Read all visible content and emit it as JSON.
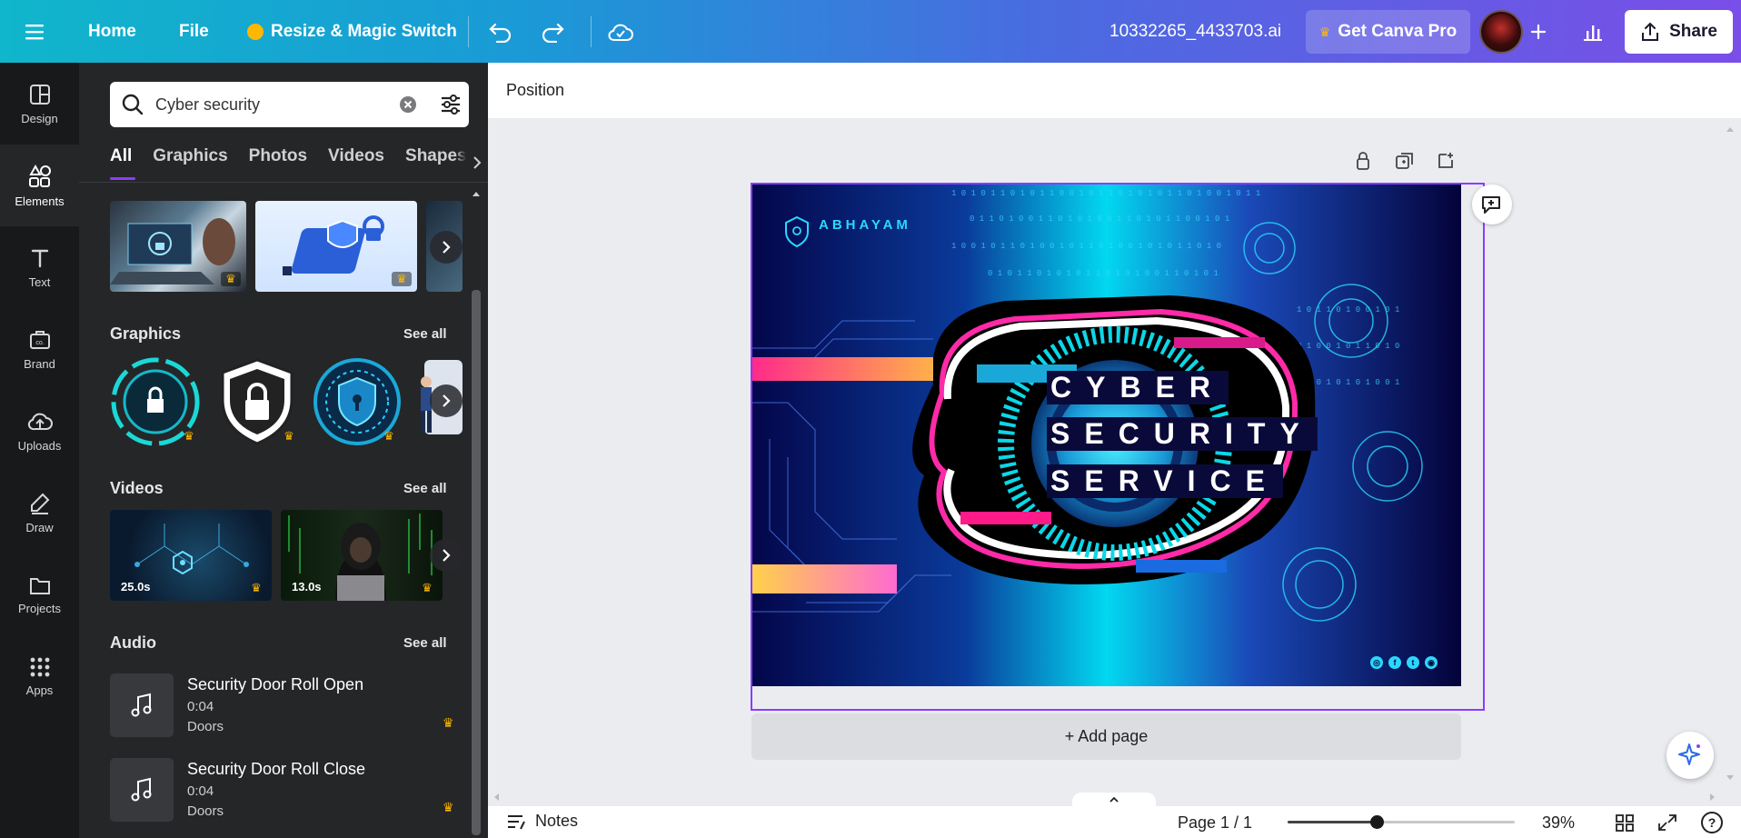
{
  "topbar": {
    "home": "Home",
    "file": "File",
    "resize": "Resize & Magic Switch",
    "filename": "10332265_4433703.ai",
    "get_pro": "Get Canva Pro",
    "share": "Share"
  },
  "sidebar": {
    "items": [
      {
        "label": "Design",
        "icon": "design-icon"
      },
      {
        "label": "Elements",
        "icon": "elements-icon"
      },
      {
        "label": "Text",
        "icon": "text-icon"
      },
      {
        "label": "Brand",
        "icon": "brand-icon"
      },
      {
        "label": "Uploads",
        "icon": "uploads-icon"
      },
      {
        "label": "Draw",
        "icon": "draw-icon"
      },
      {
        "label": "Projects",
        "icon": "projects-icon"
      },
      {
        "label": "Apps",
        "icon": "apps-icon"
      }
    ]
  },
  "panel": {
    "search_value": "Cyber security",
    "tabs": [
      "All",
      "Graphics",
      "Photos",
      "Videos",
      "Shapes"
    ],
    "graphics_title": "Graphics",
    "videos_title": "Videos",
    "audio_title": "Audio",
    "see_all": "See all",
    "videos": [
      {
        "duration": "25.0s"
      },
      {
        "duration": "13.0s"
      }
    ],
    "audio": [
      {
        "title": "Security Door Roll Open",
        "duration": "0:04",
        "artist": "Doors"
      },
      {
        "title": "Security Door Roll Close",
        "duration": "0:04",
        "artist": "Doors"
      }
    ]
  },
  "editor": {
    "position_label": "Position",
    "add_page": "+ Add page",
    "notes": "Notes",
    "page_indicator": "Page 1 / 1",
    "zoom": "39%",
    "zoom_fraction": 0.39
  },
  "design": {
    "brand": "ABHAYAM",
    "line1": "CYBER",
    "line2": "SECURITY",
    "line3": "SERVICE"
  },
  "colors": {
    "accent": "#8b3dff",
    "pro_crown": "#ffb800"
  }
}
